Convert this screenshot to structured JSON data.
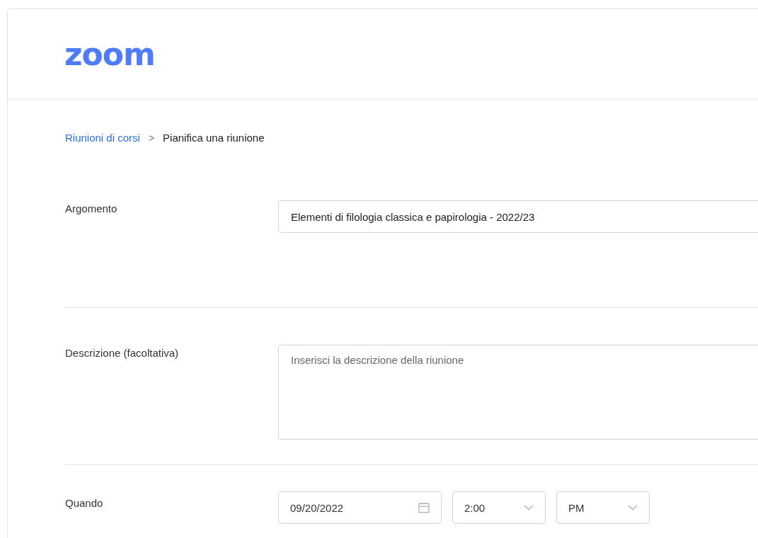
{
  "logo": "zoom",
  "breadcrumb": {
    "parent": "Riunioni di corsi",
    "separator": ">",
    "current": "Pianifica una riunione"
  },
  "topic": {
    "label": "Argomento",
    "value": "Elementi di filologia classica e papirologia - 2022/23"
  },
  "description": {
    "label": "Descrizione (facoltativa)",
    "placeholder": "Inserisci la descrizione della riunione"
  },
  "when": {
    "label": "Quando",
    "date": "09/20/2022",
    "time": "2:00",
    "ampm": "PM"
  }
}
